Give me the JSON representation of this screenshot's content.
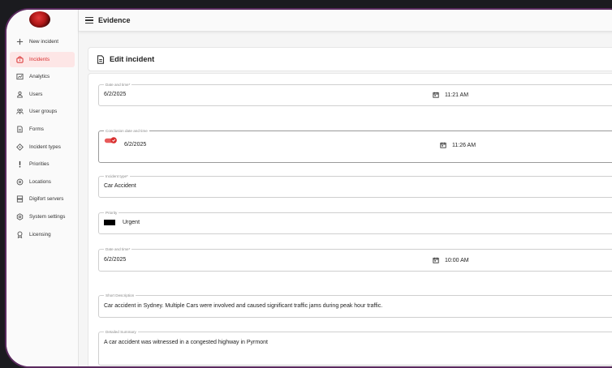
{
  "app": {
    "title": "Evidence"
  },
  "sidebar": {
    "items": [
      {
        "label": "New incident",
        "icon": "plus-icon",
        "active": false
      },
      {
        "label": "Incidents",
        "icon": "incident-icon",
        "active": true
      },
      {
        "label": "Analytics",
        "icon": "analytics-icon",
        "active": false
      },
      {
        "label": "Users",
        "icon": "user-icon",
        "active": false
      },
      {
        "label": "User groups",
        "icon": "user-groups-icon",
        "active": false
      },
      {
        "label": "Forms",
        "icon": "forms-icon",
        "active": false
      },
      {
        "label": "Incident types",
        "icon": "incident-types-icon",
        "active": false
      },
      {
        "label": "Priorities",
        "icon": "priority-icon",
        "active": false
      },
      {
        "label": "Locations",
        "icon": "location-icon",
        "active": false
      },
      {
        "label": "Digifort servers",
        "icon": "server-icon",
        "active": false
      },
      {
        "label": "System settings",
        "icon": "settings-icon",
        "active": false
      },
      {
        "label": "Licensing",
        "icon": "license-icon",
        "active": false
      }
    ]
  },
  "page": {
    "title": "Edit incident"
  },
  "form": {
    "date_time": {
      "label": "Date and time*",
      "date": "6/2/2025",
      "time": "11:21 AM"
    },
    "conclusion": {
      "label": "Conclusion date and time",
      "enabled": true,
      "date": "6/2/2025",
      "time": "11:26 AM"
    },
    "incident_type": {
      "label": "Incident type*",
      "value": "Car Accident"
    },
    "priority": {
      "label": "Priority",
      "value": "Urgent",
      "color": "#000000"
    },
    "date_time_2": {
      "label": "Date and time*",
      "date": "6/2/2025",
      "time": "10:00 AM"
    },
    "short_description": {
      "label": "Short Description",
      "value": "Car accident in Sydney. Multiple Cars were involved and caused significant traffic jams during peak hour traffic."
    },
    "detailed_summary": {
      "label": "Detailed Summary",
      "value": "A car accident was witnessed in a congested highway in Pyrmont"
    }
  },
  "colors": {
    "accent": "#d93030",
    "active_bg": "#fde6e6",
    "frame_border": "#5a2a5e"
  }
}
